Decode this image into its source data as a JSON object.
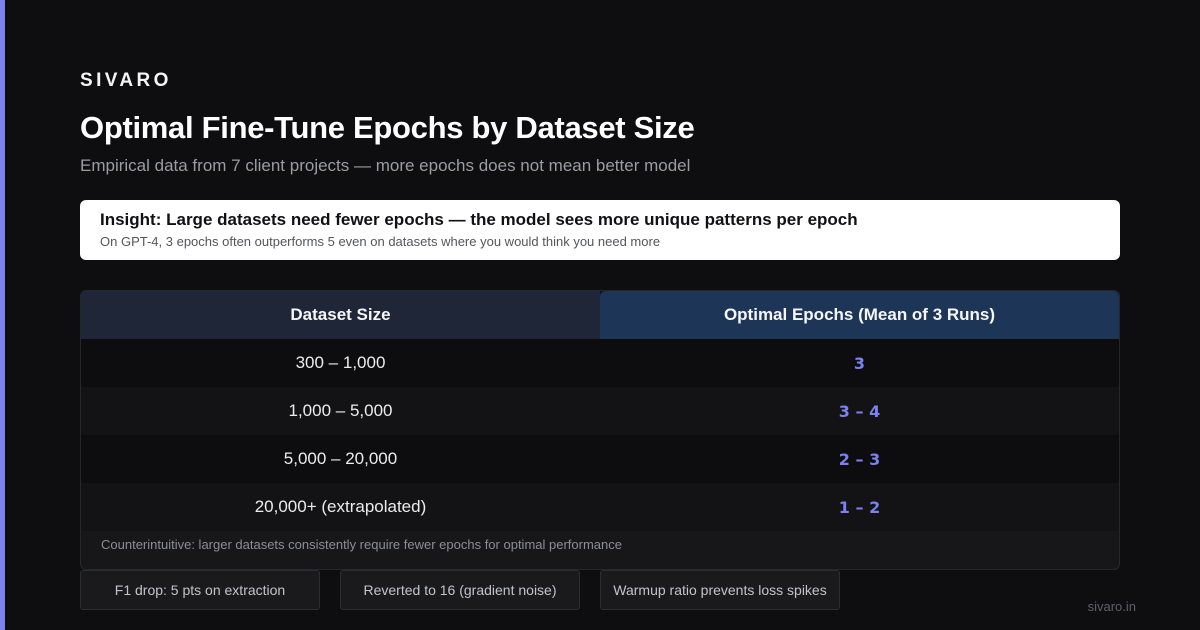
{
  "brand": "SIVARO",
  "title": "Optimal Fine-Tune Epochs by Dataset Size",
  "subtitle": "Empirical data from 7 client projects — more epochs does not mean better model",
  "insight": {
    "title": "Insight: Large datasets need fewer epochs — the model sees more unique patterns per epoch",
    "sub": "On GPT-4, 3 epochs often outperforms 5 even on datasets where you would think you need more"
  },
  "table": {
    "headers": [
      "Dataset Size",
      "Optimal Epochs (Mean of 3 Runs)"
    ],
    "rows": [
      {
        "size": "300 – 1,000",
        "epochs": "3"
      },
      {
        "size": "1,000 – 5,000",
        "epochs": "3 – 4"
      },
      {
        "size": "5,000 – 20,000",
        "epochs": "2 – 3"
      },
      {
        "size": "20,000+ (extrapolated)",
        "epochs": "1 – 2"
      }
    ],
    "footnote": "Counterintuitive: larger datasets consistently require fewer epochs for optimal performance"
  },
  "tags": [
    "F1 drop: 5 pts on extraction",
    "Reverted to 16 (gradient noise)",
    "Warmup ratio prevents loss spikes"
  ],
  "site": "sivaro.in",
  "colors": {
    "background": "#0e0e10",
    "accent": "#7b82ee",
    "header_left": "#1e2638",
    "header_right": "#1d3557"
  }
}
